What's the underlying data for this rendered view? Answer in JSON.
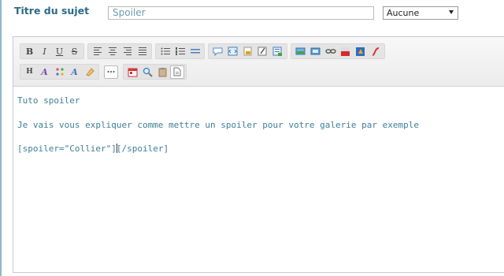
{
  "form": {
    "subject_label": "Titre du sujet",
    "subject_value": "Spoiler",
    "select_value": "Aucune"
  },
  "toolbar": {
    "row1": [
      {
        "name": "bold",
        "glyph": "B"
      },
      {
        "name": "italic",
        "glyph": "I"
      },
      {
        "name": "underline",
        "glyph": "U"
      },
      {
        "name": "strikethrough",
        "glyph": "S"
      }
    ],
    "row2_text": [
      {
        "name": "heading",
        "glyph": "H"
      },
      {
        "name": "font-color",
        "glyph": "A"
      },
      {
        "name": "font-size",
        "glyph": "A"
      }
    ]
  },
  "editor": {
    "line1": "Tuto spoiler",
    "line2": "Je vais vous expliquer comme mettre un spoiler pour votre galerie par exemple",
    "line3_before_cursor": "[spoiler=\"Collier\"]",
    "line3_after_cursor": "[/spoiler]"
  },
  "colors": {
    "label": "#2c6b87",
    "editor_text": "#3f7f95",
    "frame": "#8fb9c9"
  }
}
